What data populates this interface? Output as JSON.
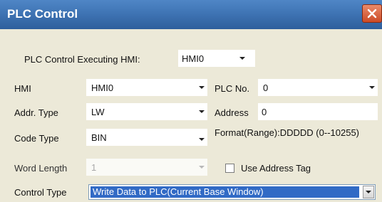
{
  "window": {
    "title": "PLC Control"
  },
  "executing_hmi": {
    "label": "PLC Control Executing HMI:",
    "value": "HMI0"
  },
  "hmi": {
    "label": "HMI",
    "value": "HMI0"
  },
  "plc_no": {
    "label": "PLC No.",
    "value": "0"
  },
  "addr_type": {
    "label": "Addr. Type",
    "value": "LW"
  },
  "address": {
    "label": "Address",
    "value": "0"
  },
  "code_type": {
    "label": "Code Type",
    "value": "BIN"
  },
  "format_text": "Format(Range):DDDDD (0--10255)",
  "word_length": {
    "label": "Word Length",
    "value": "1"
  },
  "use_address_tag": {
    "label": "Use Address Tag"
  },
  "control_type": {
    "label": "Control Type",
    "value": "Write Data to PLC(Current Base Window)"
  },
  "colors": {
    "title_bar": "#3f74b4",
    "panel": "#ece9d8",
    "selection": "#316ac5"
  },
  "icons": [
    "close-icon",
    "chevron-down-icon",
    "checkbox-unchecked-icon"
  ]
}
